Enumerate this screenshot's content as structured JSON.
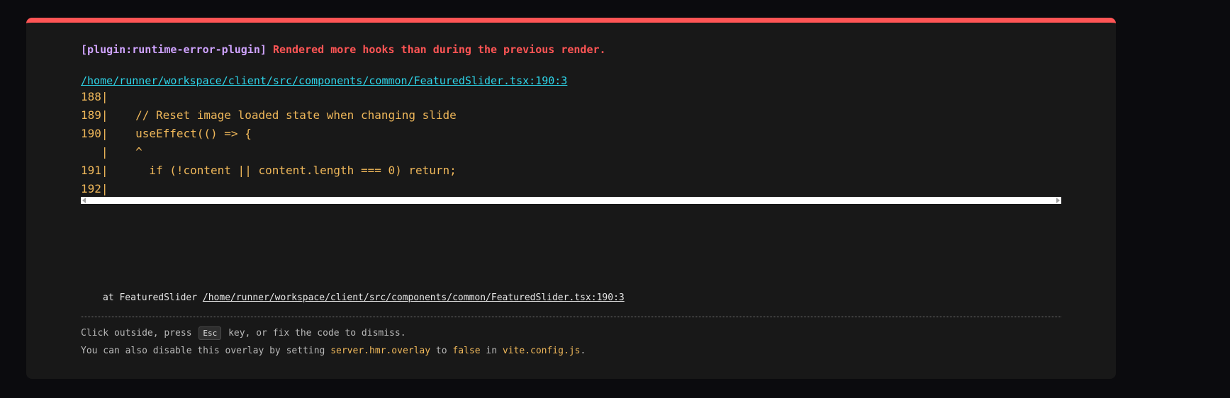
{
  "error": {
    "plugin": "[plugin:runtime-error-plugin]",
    "message": "Rendered more hooks than during the previous render.",
    "file_link": "/home/runner/workspace/client/src/components/common/FeaturedSlider.tsx:190:3"
  },
  "code_frame": {
    "lines": [
      "188|",
      "189|    // Reset image loaded state when changing slide",
      "190|    useEffect(() => {",
      "   |    ^",
      "191|      if (!content || content.length === 0) return;",
      "192|"
    ]
  },
  "stack": {
    "prefix": "at FeaturedSlider",
    "link": "/home/runner/workspace/client/src/components/common/FeaturedSlider.tsx:190:3"
  },
  "tips": {
    "line1_before": "Click outside, press",
    "esc_key": "Esc",
    "line1_after": "key, or fix the code to dismiss.",
    "line2_before": "You can also disable this overlay by setting",
    "config_key": "server.hmr.overlay",
    "line2_to": "to",
    "false_value": "false",
    "line2_in": "in",
    "config_file": "vite.config.js",
    "line2_end": "."
  },
  "colors": {
    "accent_red": "#ff5555",
    "plugin_purple": "#cfa3ff",
    "link_cyan": "#2dd4e8",
    "code_yellow": "#f0b85a"
  }
}
